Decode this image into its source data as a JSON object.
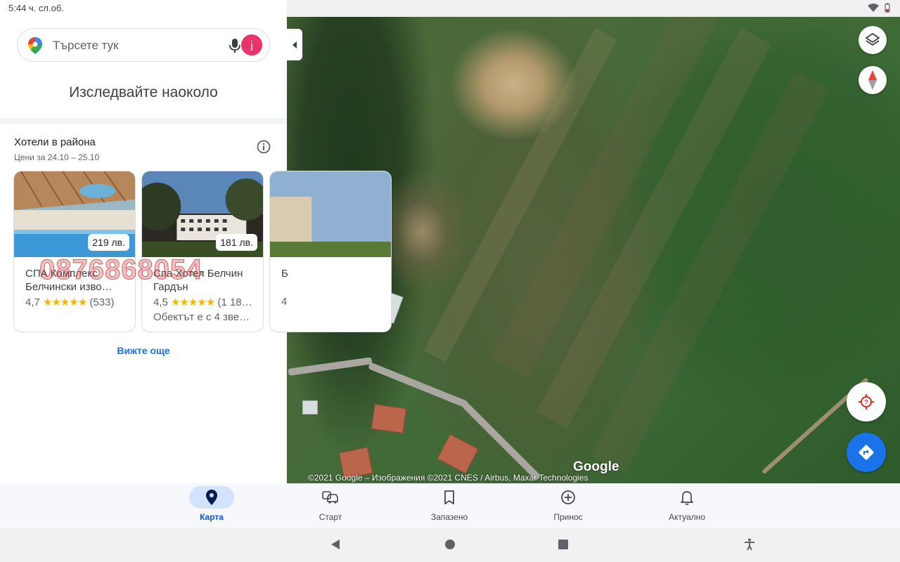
{
  "status_bar": {
    "time": "5:44 ч. сл.об."
  },
  "search": {
    "placeholder": "Търсете тук",
    "avatar_letter": "j"
  },
  "explore": {
    "title": "Изследвайте наоколо"
  },
  "hotels": {
    "title": "Хотели в района",
    "subtitle": "Цени за 24.10 – 25.10",
    "cards": [
      {
        "price": "219 лв.",
        "name_line1": "СПА Комплекс",
        "name_line2": "Белчински изво…",
        "rating": "4,7",
        "stars": "★★★★★",
        "reviews": "(533)",
        "desc": ""
      },
      {
        "price": "181 лв.",
        "name_line1": "Спа Хотел Белчин",
        "name_line2": "Гардън",
        "rating": "4,5",
        "stars": "★★★★★",
        "reviews": "(1 18…",
        "desc": "Обектът е с 4 зве…"
      },
      {
        "price": "",
        "name_line1": "Б",
        "name_line2": "",
        "rating": "4",
        "stars": "",
        "reviews": "",
        "desc": ""
      }
    ],
    "see_more": "Вижте още"
  },
  "watermark": "0876868054",
  "map": {
    "google_logo": "Google",
    "copyright": "©2021 Google – Изображения ©2021 CNES / Airbus, Maxar Technologies"
  },
  "bottom_nav": {
    "items": [
      {
        "label": "Карта",
        "icon": "pin-icon",
        "active": true
      },
      {
        "label": "Старт",
        "icon": "car-icon",
        "active": false
      },
      {
        "label": "Запазено",
        "icon": "bookmark-icon",
        "active": false
      },
      {
        "label": "Принос",
        "icon": "plus-circle-icon",
        "active": false
      },
      {
        "label": "Актуално",
        "icon": "bell-icon",
        "active": false
      }
    ]
  },
  "colors": {
    "accent": "#1a73e8",
    "avatar": "#e8336b",
    "star": "#f4b400",
    "watermark": "#c43c3c"
  }
}
